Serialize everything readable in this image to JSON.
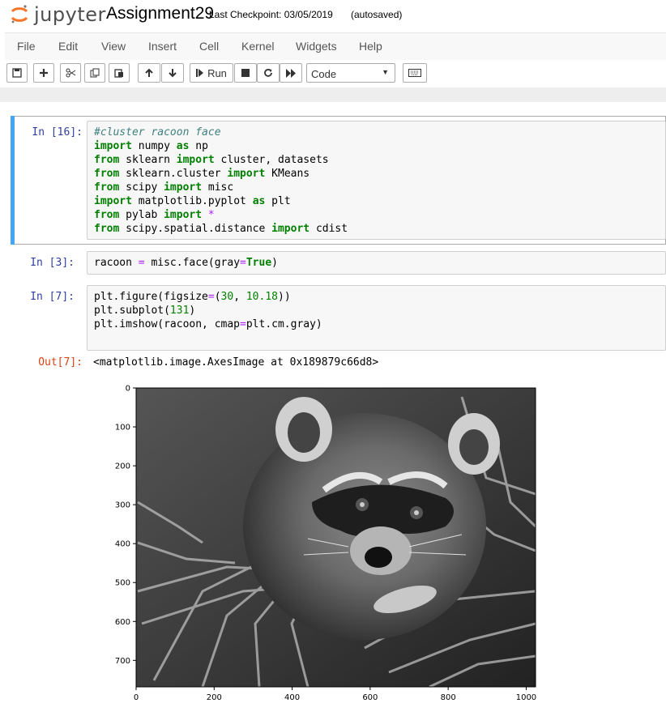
{
  "header": {
    "logo_text": "jupyter",
    "notebook_name": "Assignment29",
    "checkpoint": "Last Checkpoint: 03/05/2019",
    "autosave_status": "(autosaved)"
  },
  "menu": [
    "File",
    "Edit",
    "View",
    "Insert",
    "Cell",
    "Kernel",
    "Widgets",
    "Help"
  ],
  "toolbar": {
    "run_label": "Run",
    "cell_type": "Code"
  },
  "cells": [
    {
      "prompt": "In [16]:",
      "lines": [
        "#cluster racoon face",
        "import numpy as np",
        "from sklearn import cluster, datasets",
        "from sklearn.cluster import KMeans",
        "from scipy import misc",
        "import matplotlib.pyplot as plt",
        "from pylab import *",
        "from scipy.spatial.distance import cdist"
      ]
    },
    {
      "prompt": "In [3]:",
      "lines": [
        "racoon = misc.face(gray=True)"
      ]
    },
    {
      "prompt": "In [7]:",
      "lines": [
        "plt.figure(figsize=(30, 10.18))",
        "plt.subplot(131)",
        "plt.imshow(racoon, cmap=plt.cm.gray)"
      ]
    }
  ],
  "output": {
    "prompt": "Out[7]:",
    "text": "<matplotlib.image.AxesImage at 0x189879c66d8>"
  },
  "chart_data": {
    "type": "image",
    "xticks": [
      "0",
      "200",
      "400",
      "600",
      "800",
      "1000"
    ],
    "yticks": [
      "0",
      "100",
      "200",
      "300",
      "400",
      "500",
      "600",
      "700"
    ],
    "xlim": [
      0,
      1024
    ],
    "ylim": [
      768,
      0
    ]
  }
}
